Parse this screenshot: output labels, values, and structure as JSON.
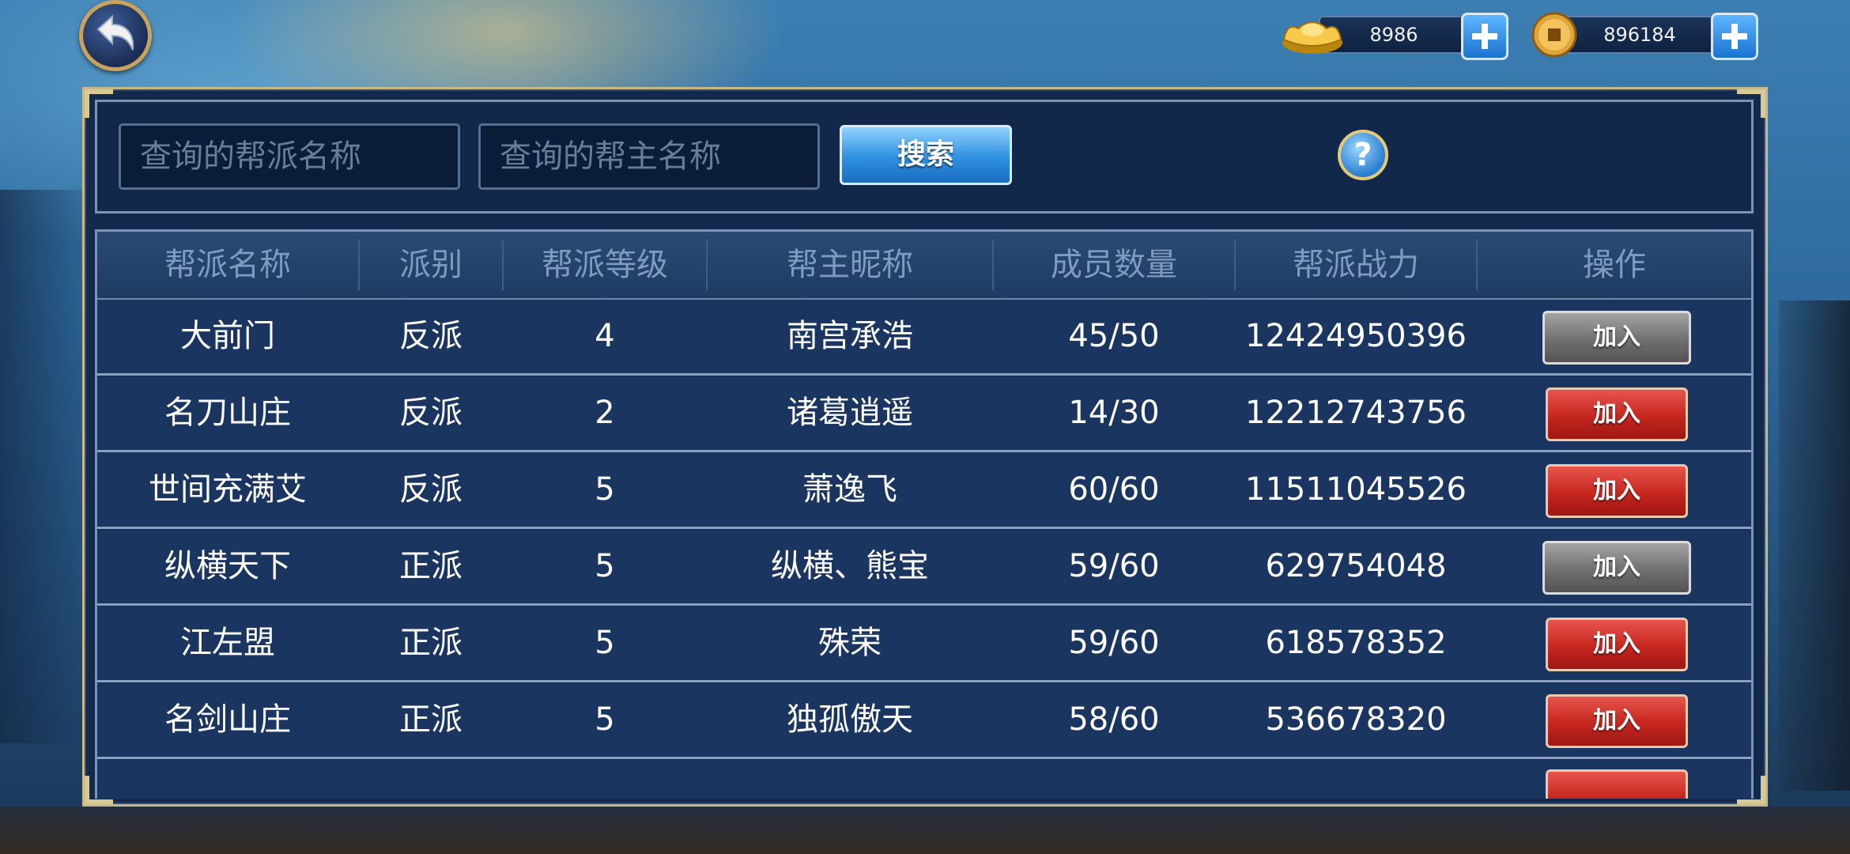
{
  "header": {
    "gold_amount": "8986",
    "coin_amount": "896184"
  },
  "search": {
    "guild_name_placeholder": "查询的帮派名称",
    "leader_name_placeholder": "查询的帮主名称",
    "search_label": "搜索",
    "help_label": "?"
  },
  "table": {
    "headers": [
      "帮派名称",
      "派别",
      "帮派等级",
      "帮主昵称",
      "成员数量",
      "帮派战力",
      "操作"
    ],
    "join_label": "加入",
    "rows": [
      {
        "name": "大前门",
        "faction": "反派",
        "level": "4",
        "leader": "南宫承浩",
        "members": "45/50",
        "power": "12424950396",
        "button_state": "gray"
      },
      {
        "name": "名刀山庄",
        "faction": "反派",
        "level": "2",
        "leader": "诸葛逍遥",
        "members": "14/30",
        "power": "12212743756",
        "button_state": "red"
      },
      {
        "name": "世间充满艾",
        "faction": "反派",
        "level": "5",
        "leader": "萧逸飞",
        "members": "60/60",
        "power": "11511045526",
        "button_state": "red"
      },
      {
        "name": "纵横天下",
        "faction": "正派",
        "level": "5",
        "leader": "纵横、熊宝",
        "members": "59/60",
        "power": "629754048",
        "button_state": "gray"
      },
      {
        "name": "江左盟",
        "faction": "正派",
        "level": "5",
        "leader": "殊荣",
        "members": "59/60",
        "power": "618578352",
        "button_state": "red"
      },
      {
        "name": "名剑山庄",
        "faction": "正派",
        "level": "5",
        "leader": "独孤傲天",
        "members": "58/60",
        "power": "536678320",
        "button_state": "red"
      }
    ]
  },
  "colors": {
    "join_active": "#c5261f",
    "join_disabled": "#707070",
    "panel_bg": "#13294d",
    "header_text": "#7f9bbe"
  },
  "icons": {
    "back": "back-arrow-icon",
    "gold": "gold-ingot-icon",
    "coin": "copper-coin-icon",
    "plus": "plus-icon",
    "help": "question-mark-icon"
  }
}
